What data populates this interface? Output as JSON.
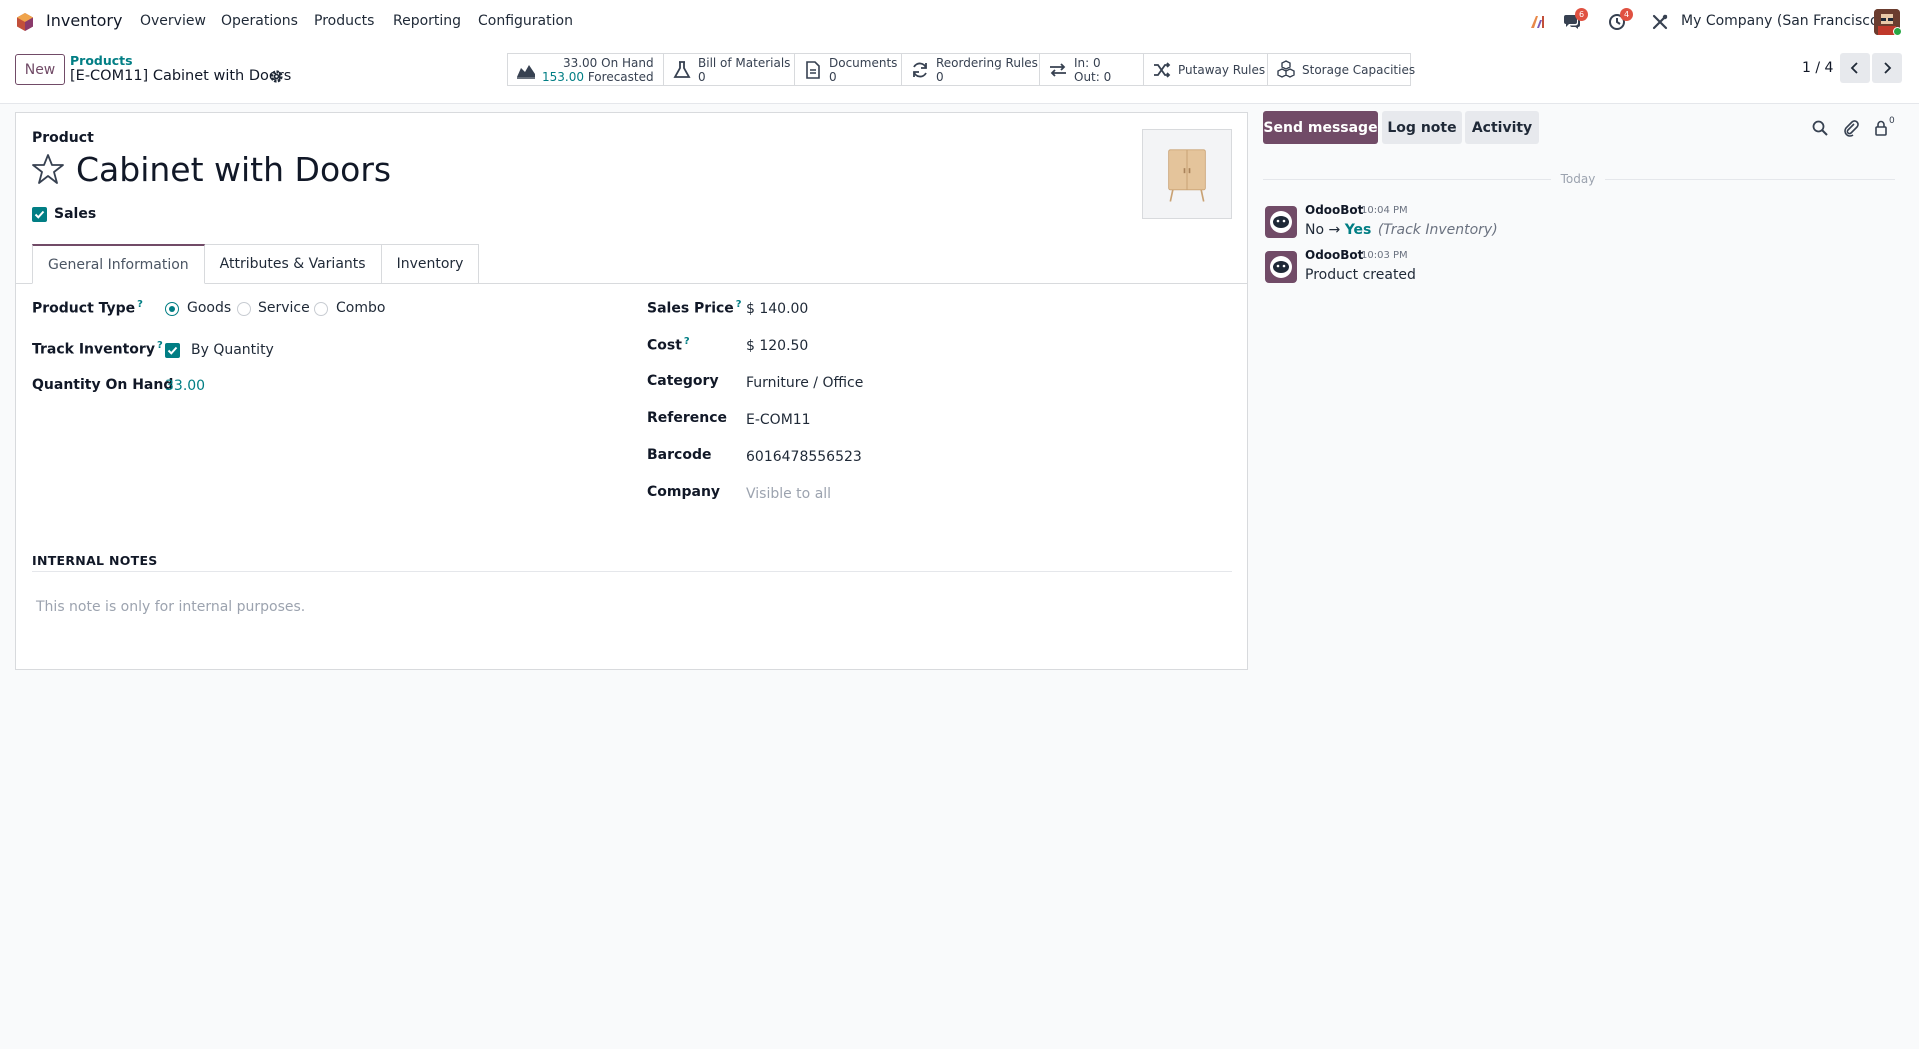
{
  "colors": {
    "brand": "#714b67",
    "accent": "#017e84",
    "badge": "#e05141"
  },
  "app": {
    "name": "Inventory"
  },
  "menu": [
    {
      "label": "Overview"
    },
    {
      "label": "Operations"
    },
    {
      "label": "Products"
    },
    {
      "label": "Reporting"
    },
    {
      "label": "Configuration"
    }
  ],
  "systray": {
    "messages_badge": "6",
    "activities_badge": "4",
    "company": "My Company (San Francisco)"
  },
  "control": {
    "new_label": "New",
    "breadcrumb_parent": "Products",
    "breadcrumb_current": "[E-COM11] Cabinet with Doors",
    "pager": "1 / 4"
  },
  "smart_buttons": {
    "on_hand": {
      "value": "33.00",
      "label": "On Hand",
      "forecast_value": "153.00",
      "forecast_label": "Forecasted"
    },
    "bom": {
      "label": "Bill of Materials",
      "count": "0"
    },
    "documents": {
      "label": "Documents",
      "count": "0"
    },
    "reordering": {
      "label": "Reordering Rules",
      "count": "0"
    },
    "moves": {
      "in": "In: 0",
      "out": "Out: 0"
    },
    "putaway": {
      "label": "Putaway Rules"
    },
    "storage": {
      "label": "Storage Capacities"
    }
  },
  "product": {
    "section_label": "Product",
    "name": "Cabinet with Doors",
    "sales_label": "Sales"
  },
  "tabs": [
    {
      "label": "General Information"
    },
    {
      "label": "Attributes & Variants"
    },
    {
      "label": "Inventory"
    }
  ],
  "fields": {
    "product_type": {
      "label": "Product Type",
      "help": "?",
      "options": [
        "Goods",
        "Service",
        "Combo"
      ],
      "selected": "Goods"
    },
    "track_inventory": {
      "label": "Track Inventory",
      "help": "?",
      "value": "By Quantity"
    },
    "qty_on_hand": {
      "label": "Quantity On Hand",
      "value": "33.00"
    },
    "sales_price": {
      "label": "Sales Price",
      "help": "?",
      "value": "$ 140.00"
    },
    "cost": {
      "label": "Cost",
      "help": "?",
      "value": "$ 120.50"
    },
    "category": {
      "label": "Category",
      "value": "Furniture / Office"
    },
    "reference": {
      "label": "Reference",
      "value": "E-COM11"
    },
    "barcode": {
      "label": "Barcode",
      "value": "6016478556523"
    },
    "company": {
      "label": "Company",
      "placeholder": "Visible to all"
    }
  },
  "notes": {
    "header": "INTERNAL NOTES",
    "placeholder": "This note is only for internal purposes."
  },
  "chatter": {
    "send_label": "Send message",
    "log_label": "Log note",
    "activity_label": "Activity",
    "followers_count": "0",
    "date_separator": "Today",
    "messages": [
      {
        "author": "OdooBot",
        "time": "10:04 PM",
        "old": "No",
        "arrow": "→",
        "new": "Yes",
        "field": "(Track Inventory)"
      },
      {
        "author": "OdooBot",
        "time": "10:03 PM",
        "body": "Product created"
      }
    ]
  }
}
